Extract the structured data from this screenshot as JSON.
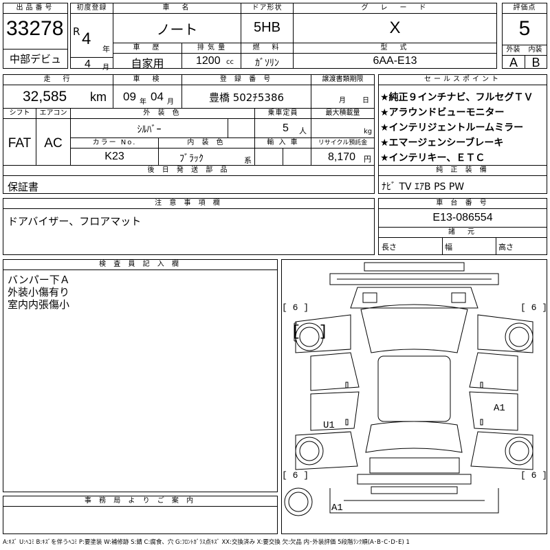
{
  "header": {
    "lot_no_label": "出品番号",
    "lot_no": "33278",
    "first_reg_label": "初度登録",
    "era": "R",
    "year": "4",
    "year_unit": "年",
    "month": "4",
    "month_unit": "月",
    "name_label": "車　名",
    "car_name": "ノート",
    "door_label": "ドア形状",
    "door_type": "5HB",
    "grade_label": "グ　レ　ー　ド",
    "grade": "X",
    "score_label": "評価点",
    "score": "5",
    "debut": "中部デビュ",
    "history_label": "車　歴",
    "history": "自家用",
    "displacement_label": "排 気 量",
    "displacement": "1200",
    "displacement_unit": "cc",
    "fuel_label": "燃　料",
    "fuel": "ｶﾞｿﾘﾝ",
    "model_label": "型　式",
    "model_code": "6AA-E13",
    "exterior_label": "外装",
    "exterior_grade": "A",
    "interior_label": "内装",
    "interior_grade": "B"
  },
  "row2": {
    "mileage_label": "走　行",
    "mileage": "32,585",
    "mileage_unit": "km",
    "inspection_label": "車　検",
    "insp_year": "09",
    "insp_year_unit": "年",
    "insp_month": "04",
    "insp_month_unit": "月",
    "reg_no_label": "登 録 番 号",
    "reg_no": "豊橋 502ﾁ5386",
    "transfer_label": "譲渡書類期限",
    "transfer_month_unit": "月",
    "transfer_day_unit": "日",
    "shift_label": "シフト",
    "shift": "FAT",
    "ac_label": "エアコン",
    "ac": "AC",
    "ext_color_label": "外 装 色",
    "ext_color": "ｼﾙﾊﾞｰ",
    "capacity_label": "乗車定員",
    "capacity": "5",
    "capacity_unit": "人",
    "max_load_label": "最大積載量",
    "max_load_unit": "kg",
    "color_no_label": "カラー No.",
    "color_no": "K23",
    "int_color_label": "内 装 色",
    "int_color": "ﾌﾞﾗｯｸ",
    "int_color_unit": "系",
    "import_label": "輸 入 車",
    "recycle_label": "リサイクル預託金",
    "recycle": "8,170",
    "recycle_unit": "円",
    "later_label": "後 日 発 送 部 品",
    "later_parts": "保証書"
  },
  "sales_points": {
    "label": "セールスポイント",
    "items": [
      "★純正９インチナビ、フルセグＴＶ",
      "★アラウンドビューモニター",
      "★インテリジェントルームミラー",
      "★エマージェンシーブレーキ",
      "★インテリキー、ＥＴＣ"
    ]
  },
  "equipment": {
    "label": "純 正 装 備",
    "value": "ﾅﾋﾞ TV ｴｱB PS PW"
  },
  "notes": {
    "label": "注 意 事 項 欄",
    "value": "ドアバイザー、フロアマット"
  },
  "chassis": {
    "label": "車 台 番 号",
    "value": "E13-086554",
    "dims_label": "諸　元",
    "length_label": "長さ",
    "width_label": "幅",
    "height_label": "高さ"
  },
  "inspector": {
    "label": "検 査 員 記 入 欄",
    "lines": [
      "バンパー下Ａ",
      "外装小傷有り",
      "室内内張傷小"
    ]
  },
  "office": {
    "label": "事 務 局 よ り ご 案 内"
  },
  "diagram": {
    "tire_marks": [
      "6",
      "6",
      "6",
      "6"
    ],
    "marks": [
      "U1",
      "A1",
      "A1"
    ]
  },
  "footer": {
    "legend": "A:ｷｽﾞ U:ﾍｺﾐ B:ｷｽﾞを伴うﾍｺﾐ P:要塗装 W:補修跡 S:錆 C:腐食、穴 G:ﾌﾛﾝﾄｶﾞﾗｽ点ｷｽﾞ XX:交換済み X:要交換 欠:欠品 内･外装評価 5段階ﾗﾝｸ順(A･B･C･D･E) 1"
  }
}
